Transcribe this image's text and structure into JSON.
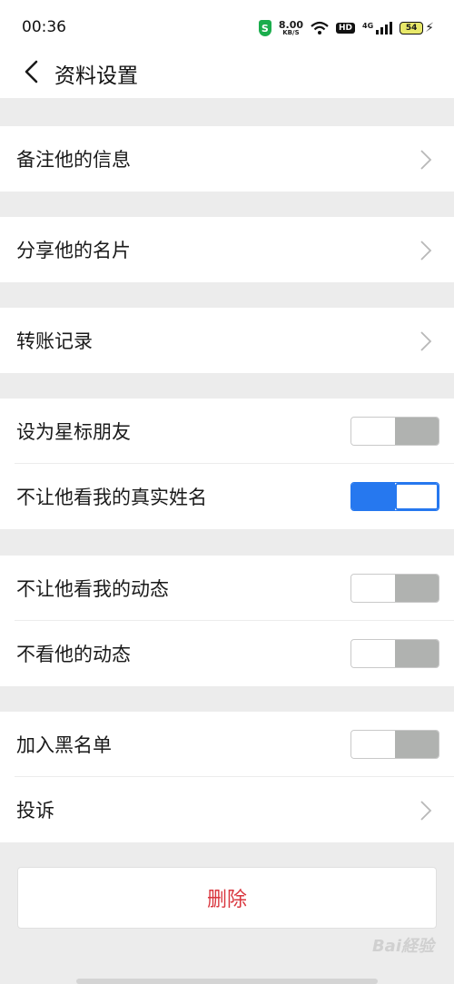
{
  "status_bar": {
    "time": "00:36",
    "shield_label": "S",
    "speed_value": "8.00",
    "speed_unit": "KB/S",
    "hd_label": "HD",
    "network_label": "4G",
    "battery_level": "54"
  },
  "nav": {
    "title": "资料设置",
    "back_icon": "chevron-left-icon"
  },
  "groups": [
    {
      "rows": [
        {
          "label": "备注他的信息",
          "control": "chevron"
        }
      ]
    },
    {
      "rows": [
        {
          "label": "分享他的名片",
          "control": "chevron"
        }
      ]
    },
    {
      "rows": [
        {
          "label": "转账记录",
          "control": "chevron"
        }
      ]
    },
    {
      "rows": [
        {
          "label": "设为星标朋友",
          "control": "toggle",
          "checked": false
        },
        {
          "label": "不让他看我的真实姓名",
          "control": "toggle",
          "checked": true
        }
      ]
    },
    {
      "rows": [
        {
          "label": "不让他看我的动态",
          "control": "toggle",
          "checked": false
        },
        {
          "label": "不看他的动态",
          "control": "toggle",
          "checked": false
        }
      ]
    },
    {
      "rows": [
        {
          "label": "加入黑名单",
          "control": "toggle",
          "checked": false
        },
        {
          "label": "投诉",
          "control": "chevron"
        }
      ]
    }
  ],
  "delete_button": {
    "label": "删除"
  },
  "colors": {
    "accent_blue": "#2678ef",
    "danger_red": "#d9363e",
    "toggle_off_gray": "#b0b2b0",
    "background": "#ececec"
  },
  "watermark": "Bai経验"
}
